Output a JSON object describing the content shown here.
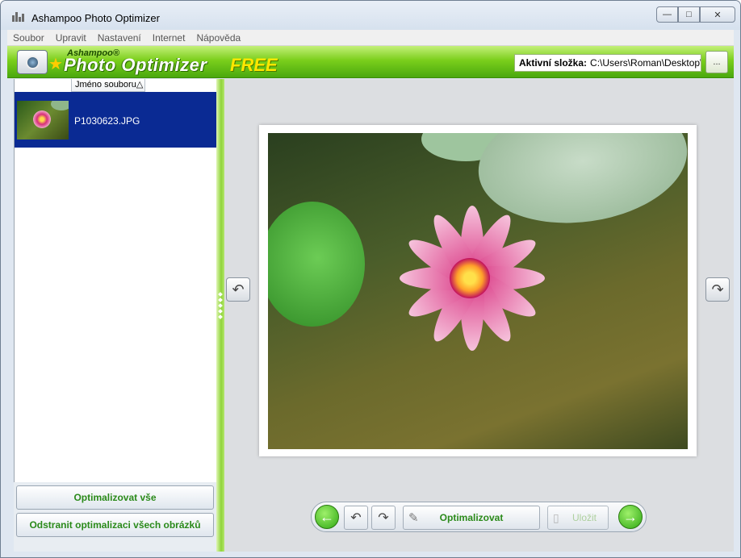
{
  "window": {
    "title": "Ashampoo Photo Optimizer",
    "controls": {
      "minimize": "—",
      "maximize": "□",
      "close": "✕"
    }
  },
  "menu": {
    "items": [
      "Soubor",
      "Upravit",
      "Nastavení",
      "Internet",
      "Nápověda"
    ]
  },
  "banner": {
    "brand_small": "Ashampoo®",
    "brand_big": "Photo Optimizer",
    "brand_free": "FREE",
    "folder_label": "Aktivní složka:",
    "folder_path": "C:\\Users\\Roman\\Desktop\\",
    "browse_label": "..."
  },
  "file_list": {
    "column_header": "Jméno souboru",
    "sort_indicator": "△",
    "files": [
      {
        "name": "P1030623.JPG",
        "selected": true
      }
    ]
  },
  "actions": {
    "optimize_all": "Optimalizovat vše",
    "remove_all": "Odstranit optimalizaci všech obrázků"
  },
  "toolbar": {
    "prev_icon": "left-arrow-icon",
    "rotate_left_icon": "rotate-left-icon",
    "rotate_right_icon": "rotate-right-icon",
    "optimize_label": "Optimalizovat",
    "save_label": "Uložit",
    "save_enabled": false,
    "next_icon": "right-arrow-icon"
  },
  "colors": {
    "accent_green": "#2a8a1a",
    "selection_blue": "#0a2a93",
    "banner_green": "#7bcf1c"
  }
}
